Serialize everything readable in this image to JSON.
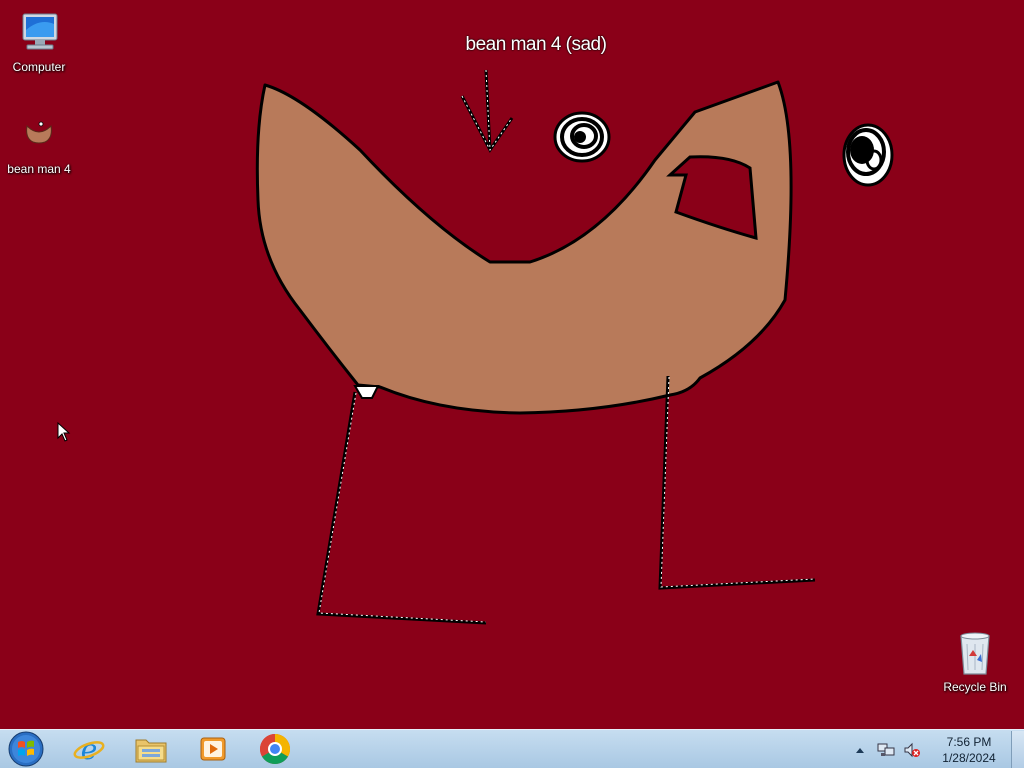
{
  "wallpaper": {
    "caption": "bean man 4 (sad)",
    "background_color": "#8a0018",
    "bean_color": "#b87a5a"
  },
  "desktop_icons": [
    {
      "label": "Computer",
      "icon": "computer-icon"
    },
    {
      "label": "bean man 4",
      "icon": "image-icon"
    },
    {
      "label": "Recycle Bin",
      "icon": "recycle-bin-icon"
    }
  ],
  "taskbar": {
    "start_icon": "windows-logo-icon",
    "pinned": [
      {
        "icon": "internet-explorer-icon"
      },
      {
        "icon": "file-explorer-icon"
      },
      {
        "icon": "media-player-icon"
      },
      {
        "icon": "chrome-icon"
      }
    ],
    "tray": {
      "show_hidden_icon": "up-arrow-icon",
      "network_icon": "network-icon",
      "volume_icon": "volume-muted-icon",
      "time": "7:56 PM",
      "date": "1/28/2024"
    }
  }
}
